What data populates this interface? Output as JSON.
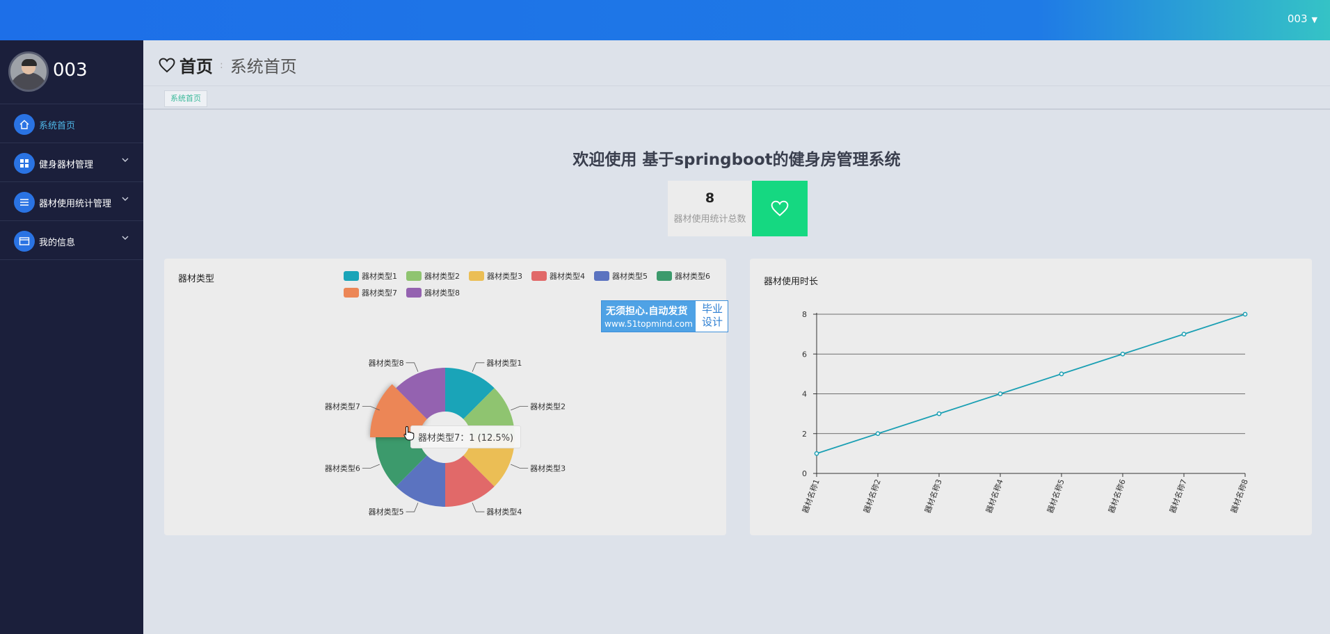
{
  "topbar": {
    "user_label": "003"
  },
  "sidebar": {
    "profile_name": "003",
    "items": [
      {
        "label": "系统首页",
        "icon": "home-icon",
        "active": true
      },
      {
        "label": "健身器材管理",
        "icon": "grid-icon",
        "expandable": true
      },
      {
        "label": "器材使用统计管理",
        "icon": "list-icon",
        "expandable": true
      },
      {
        "label": "我的信息",
        "icon": "card-icon",
        "expandable": true
      }
    ]
  },
  "header": {
    "home_label": "首页",
    "current_label": "系统首页"
  },
  "tabs": [
    {
      "label": "系统首页"
    }
  ],
  "welcome": "欢迎使用 基于springboot的健身房管理系统",
  "stat": {
    "value": "8",
    "caption": "器材使用统计总数"
  },
  "watermark": {
    "line1": "无须担心.自动发货",
    "line2": "www.51topmind.com",
    "right1": "毕业",
    "right2": "设计"
  },
  "tooltip": "器材类型7：1 (12.5%)",
  "colors": {
    "accent": "#1d6fe8",
    "sidebar": "#1b1f3b",
    "stat_green": "#15d881",
    "line": "#1a9fb3"
  },
  "chart_data": [
    {
      "type": "pie",
      "donut": true,
      "title": "器材类型",
      "legend_position": "top-right",
      "categories": [
        "器材类型1",
        "器材类型2",
        "器材类型3",
        "器材类型4",
        "器材类型5",
        "器材类型6",
        "器材类型7",
        "器材类型8"
      ],
      "values": [
        1,
        1,
        1,
        1,
        1,
        1,
        1,
        1
      ],
      "colors": [
        "#1aa4b8",
        "#8fc470",
        "#ebbe55",
        "#e16969",
        "#5b73c0",
        "#3c9a6c",
        "#ec8656",
        "#9462b0"
      ],
      "highlighted": "器材类型7"
    },
    {
      "type": "line",
      "title": "器材使用时长",
      "x": [
        "器材名称1",
        "器材名称2",
        "器材名称3",
        "器材名称4",
        "器材名称5",
        "器材名称6",
        "器材名称7",
        "器材名称8"
      ],
      "values": [
        1,
        2,
        3,
        4,
        5,
        6,
        7,
        8
      ],
      "ylim": [
        0,
        8
      ],
      "yticks": [
        "0",
        "2",
        "4",
        "6",
        "8"
      ],
      "grid": true
    }
  ]
}
